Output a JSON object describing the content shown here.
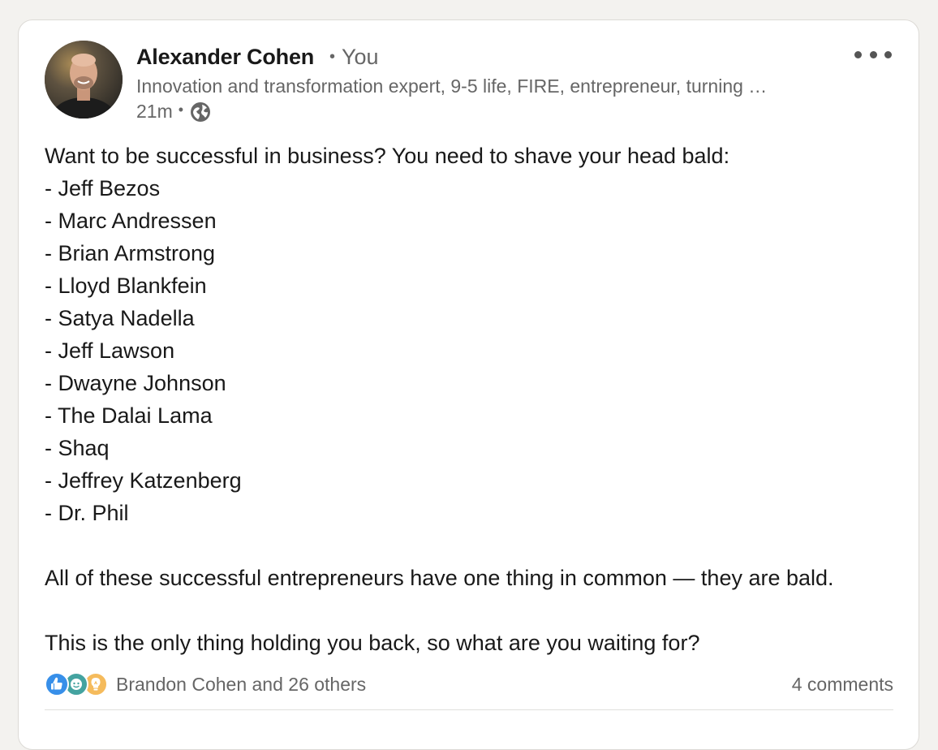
{
  "author": {
    "name": "Alexander Cohen",
    "relation": "You",
    "headline": "Innovation and transformation expert, 9-5 life, FIRE, entrepreneur, turning …",
    "time_ago": "21m",
    "visibility_icon": "globe-icon"
  },
  "post": {
    "lines": [
      "Want to be successful in business? You need to shave your head bald:",
      "- Jeff Bezos",
      "- Marc Andressen",
      "- Brian Armstrong",
      "- Lloyd Blankfein",
      "- Satya Nadella",
      "- Jeff Lawson",
      "- Dwayne Johnson",
      "- The Dalai Lama",
      "- Shaq",
      "- Jeffrey Katzenberg",
      "- Dr. Phil",
      "",
      "All of these successful entrepreneurs have one thing in common — they are bald.",
      "",
      "This is the only thing holding you back, so what are you waiting for?"
    ]
  },
  "social": {
    "reaction_icons": [
      "like-reaction-icon",
      "celebrate-reaction-icon",
      "insightful-reaction-icon"
    ],
    "reactors_text": "Brandon Cohen and 26 others",
    "comments_text": "4 comments"
  },
  "colors": {
    "page_background": "#f3f2ef",
    "card_background": "#ffffff",
    "primary_text": "#191919",
    "secondary_text": "#666666",
    "like_blue": "#378fe9",
    "celebrate_green": "#44a3a0",
    "insight_yellow": "#f5bb5c"
  }
}
